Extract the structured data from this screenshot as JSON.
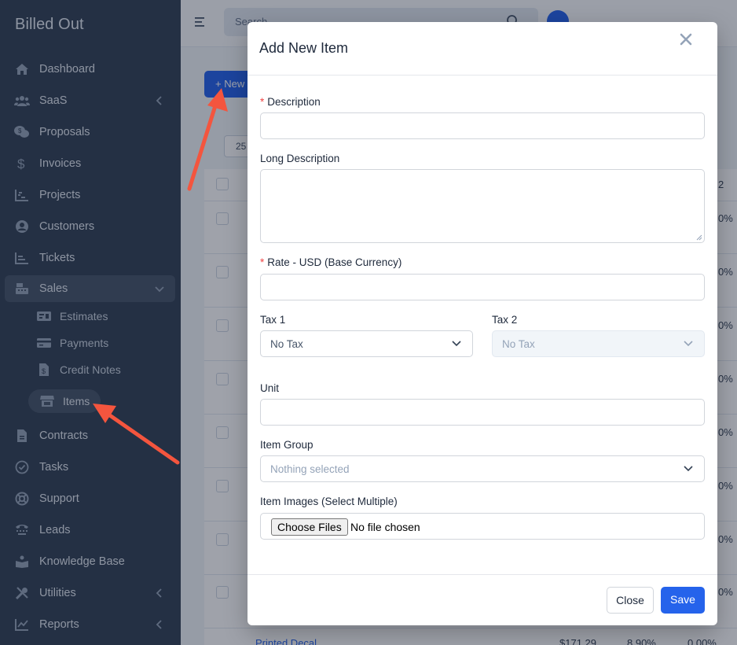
{
  "sidebar": {
    "brand": "Billed Out",
    "items": [
      {
        "label": "Dashboard",
        "icon": "home-icon"
      },
      {
        "label": "SaaS",
        "icon": "users-icon"
      },
      {
        "label": "Proposals",
        "icon": "proposals-icon"
      },
      {
        "label": "Invoices",
        "icon": "dollar-icon"
      },
      {
        "label": "Projects",
        "icon": "chart-icon"
      },
      {
        "label": "Customers",
        "icon": "user-circle-icon"
      },
      {
        "label": "Tickets",
        "icon": "ticket-chart-icon"
      },
      {
        "label": "Sales",
        "icon": "register-icon"
      },
      {
        "label": "Contracts",
        "icon": "file-icon"
      },
      {
        "label": "Tasks",
        "icon": "check-circle-icon"
      },
      {
        "label": "Support",
        "icon": "lifebuoy-icon"
      },
      {
        "label": "Leads",
        "icon": "tty-icon"
      },
      {
        "label": "Knowledge Base",
        "icon": "book-reader-icon"
      },
      {
        "label": "Utilities",
        "icon": "tools-icon"
      },
      {
        "label": "Reports",
        "icon": "line-chart-icon"
      }
    ],
    "sales_sub": [
      {
        "label": "Estimates",
        "icon": "estimate-icon"
      },
      {
        "label": "Payments",
        "icon": "credit-card-icon"
      },
      {
        "label": "Credit Notes",
        "icon": "credit-note-icon"
      },
      {
        "label": "Items",
        "icon": "store-icon"
      }
    ]
  },
  "topbar": {
    "search_placeholder": "Search"
  },
  "background": {
    "new_button": "+ New",
    "page_size": "25",
    "col_fragment": "2",
    "pct_fragment": "0%",
    "last_row": {
      "name": "Printed Decal",
      "rate": "$171.29",
      "tax1": "8.90%",
      "tax2": "0.00%"
    }
  },
  "modal": {
    "title": "Add New Item",
    "description_label": "Description",
    "long_description_label": "Long Description",
    "rate_label": "Rate - USD (Base Currency)",
    "tax1_label": "Tax 1",
    "tax1_value": "No Tax",
    "tax2_label": "Tax 2",
    "tax2_value": "No Tax",
    "unit_label": "Unit",
    "item_group_label": "Item Group",
    "item_group_placeholder": "Nothing selected",
    "images_label": "Item Images (Select Multiple)",
    "choose_files": "Choose Files",
    "no_file": "No file chosen",
    "close_button": "Close",
    "save_button": "Save"
  },
  "colors": {
    "sidebar_bg": "#334155",
    "primary": "#2563eb",
    "annotation_arrow": "#f4553e",
    "required": "#ef4444"
  }
}
